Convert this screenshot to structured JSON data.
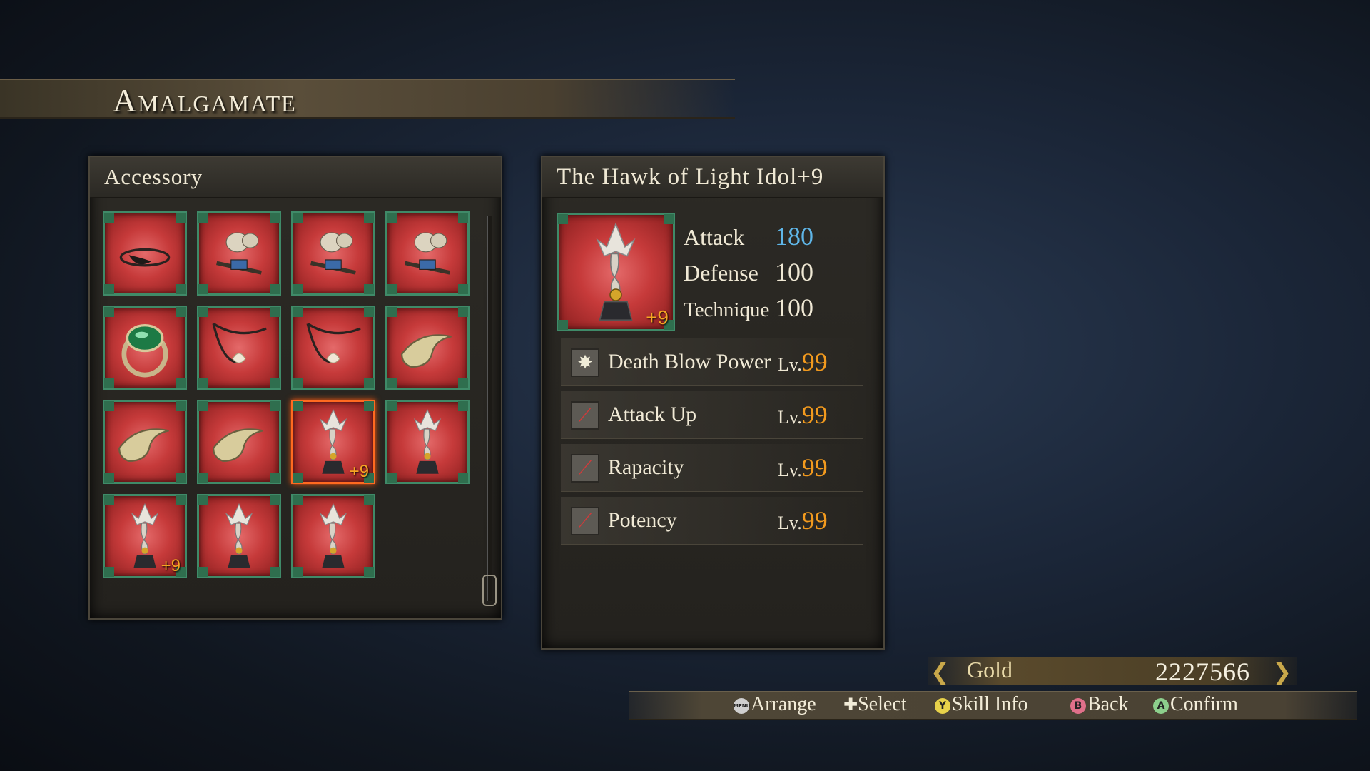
{
  "header": {
    "title": "Amalgamate"
  },
  "accessory_panel": {
    "title": "Accessory",
    "items": [
      {
        "icon": "eyepatch-icon",
        "badge": ""
      },
      {
        "icon": "hourglass-charm-icon",
        "badge": ""
      },
      {
        "icon": "hourglass-charm-icon",
        "badge": ""
      },
      {
        "icon": "hourglass-charm-icon",
        "badge": ""
      },
      {
        "icon": "emerald-ring-icon",
        "badge": ""
      },
      {
        "icon": "shell-necklace-icon",
        "badge": ""
      },
      {
        "icon": "shell-necklace-icon",
        "badge": ""
      },
      {
        "icon": "horn-icon",
        "badge": ""
      },
      {
        "icon": "horn-icon",
        "badge": ""
      },
      {
        "icon": "horn-icon",
        "badge": ""
      },
      {
        "icon": "hawk-idol-icon",
        "badge": "+9",
        "selected": true
      },
      {
        "icon": "hawk-idol-icon",
        "badge": ""
      },
      {
        "icon": "hawk-idol-icon",
        "badge": "+9"
      },
      {
        "icon": "hawk-idol-icon",
        "badge": ""
      },
      {
        "icon": "hawk-idol-icon",
        "badge": ""
      }
    ]
  },
  "detail_panel": {
    "title": "The Hawk of Light Idol+9",
    "badge": "+9",
    "stats": {
      "attack_label": "Attack",
      "attack_value": "180",
      "attack_color": "#5fb6e8",
      "defense_label": "Defense",
      "defense_value": "100",
      "technique_label": "Technique",
      "technique_value": "100"
    },
    "skills": [
      {
        "name": "Death Blow Power",
        "lv_label": "Lv.",
        "lv": "99",
        "icon": "starburst-icon"
      },
      {
        "name": "Attack Up",
        "lv_label": "Lv.",
        "lv": "99",
        "icon": "red-sword-icon"
      },
      {
        "name": "Rapacity",
        "lv_label": "Lv.",
        "lv": "99",
        "icon": "red-sword-icon"
      },
      {
        "name": "Potency",
        "lv_label": "Lv.",
        "lv": "99",
        "icon": "red-sword-icon"
      }
    ]
  },
  "gold": {
    "label": "Gold",
    "value": "2227566"
  },
  "controls": {
    "arrange": "Arrange",
    "select": "Select",
    "skill_info": "Skill Info",
    "back": "Back",
    "confirm": "Confirm",
    "menu_btn": "MENU",
    "y_btn": "Y",
    "b_btn": "B",
    "a_btn": "A"
  },
  "colors": {
    "slot_border": "#3f8a68",
    "selected_border": "#ff6a20",
    "level": "#f29a1e",
    "badge": "#f6a423"
  }
}
